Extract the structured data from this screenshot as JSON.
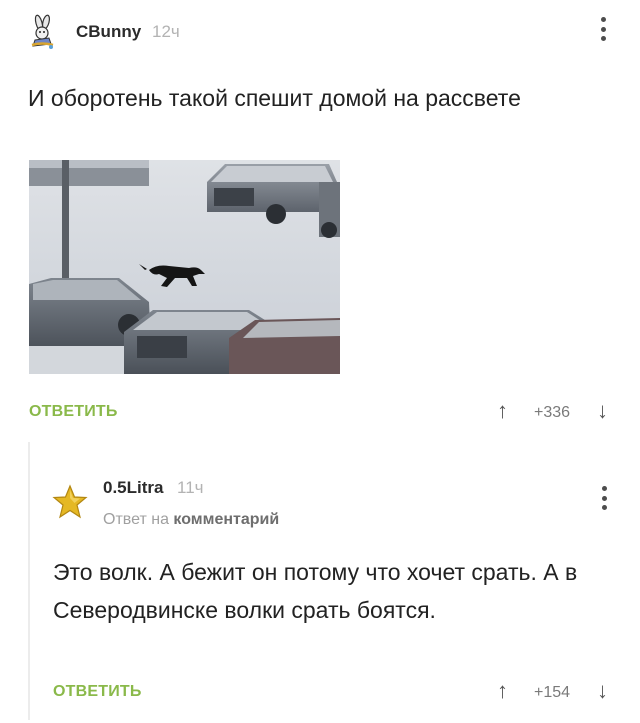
{
  "comment": {
    "author": "CBunny",
    "time": "12ч",
    "text": "И оборотень такой спешит домой на рассвете",
    "reply_label": "ОТВЕТИТЬ",
    "score": "+336",
    "up_arrow": "↑",
    "down_arrow": "↓",
    "avatar_icon": "bunny-avatar-icon",
    "image_subject": "wolf-running-in-snowy-parking-lot"
  },
  "reply": {
    "author": "0.5Litra",
    "time": "11ч",
    "reply_prefix": "Ответ на",
    "reply_target": "комментарий",
    "text": "Это волк. А бежит он потому что хочет срать. А в Северодвинске волки срать боятся.",
    "reply_label": "ОТВЕТИТЬ",
    "score": "+154",
    "up_arrow": "↑",
    "down_arrow": "↓",
    "avatar_icon": "star-avatar-icon"
  },
  "colors": {
    "accent_green": "#8ab94a",
    "muted": "#b3b3b3"
  }
}
